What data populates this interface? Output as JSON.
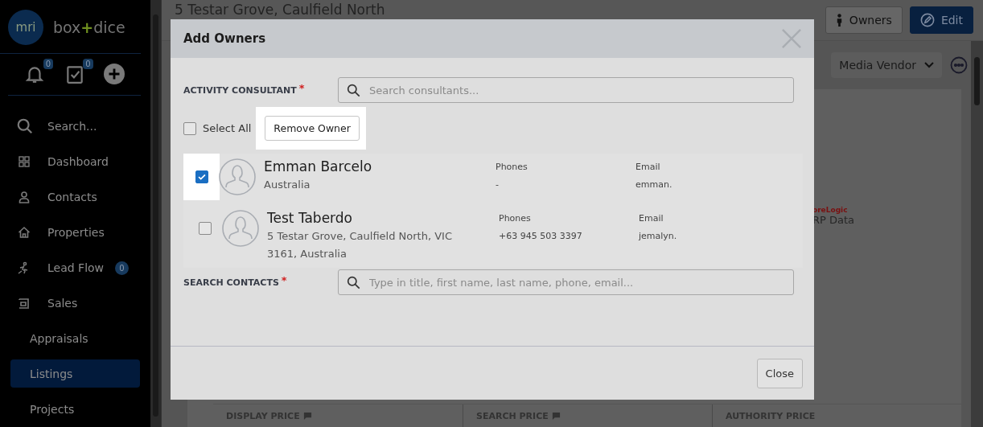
{
  "sidebar": {
    "logo_mark": "mri",
    "brand": "box**+**dice",
    "quick_icons": [
      {
        "kind": "bell",
        "badge": "0"
      },
      {
        "kind": "tasks",
        "badge": "0"
      },
      {
        "kind": "add"
      }
    ],
    "items": [
      {
        "kind": "search",
        "label": "Search...",
        "selected": false
      },
      {
        "kind": "dashboard",
        "label": "Dashboard",
        "selected": false
      },
      {
        "kind": "contacts",
        "label": "Contacts",
        "selected": false
      },
      {
        "kind": "properties",
        "label": "Properties",
        "selected": false
      },
      {
        "kind": "leadflow",
        "label": "Lead Flow",
        "badge": "0",
        "selected": false
      },
      {
        "kind": "sales",
        "label": "Sales",
        "selected": false
      },
      {
        "kind": "sub",
        "label": "Appraisals",
        "selected": false
      },
      {
        "kind": "sub",
        "label": "Listings",
        "selected": true
      },
      {
        "kind": "sub",
        "label": "Projects",
        "selected": false
      }
    ]
  },
  "header": {
    "title": "5 Testar Grove, Caulfield North",
    "buttons": [
      {
        "kind": "owners",
        "label": "Owners"
      },
      {
        "kind": "edit",
        "label": "Edit"
      }
    ]
  },
  "toolbar": {
    "dropdown": "Media Vendor"
  },
  "logo_fragment": {
    "top": "oreLogic",
    "bottom": "RP Data"
  },
  "price_columns": [
    {
      "label": "DISPLAY PRICE",
      "flag": true
    },
    {
      "label": "SEARCH PRICE",
      "flag": true
    },
    {
      "label": "AUTHORITY PRICE",
      "flag": false
    }
  ],
  "modal": {
    "title": "Add Owners",
    "consultant": {
      "label": "ACTIVITY CONSULTANT",
      "required_mark": "*",
      "placeholder": "Search consultants..."
    },
    "select_all": {
      "label": "Select All",
      "checked": false
    },
    "remove_button": "Remove Owner",
    "contacts": [
      {
        "name": "Emman Barcelo",
        "address": "Australia",
        "phones_label": "Phones",
        "phone": "-",
        "email_label": "Email",
        "email": "emman.",
        "checked": true
      },
      {
        "name": "Test Taberdo",
        "address": "5 Testar Grove, Caulfield North, VIC 3161, Australia",
        "phones_label": "Phones",
        "phone": "+63 945 503 3397",
        "email_label": "Email",
        "email": "jemalyn.",
        "checked": false
      }
    ],
    "search_contacts": {
      "label": "SEARCH CONTACTS",
      "required_mark": "*",
      "placeholder": "Type in title, first name, last name, phone, email..."
    },
    "close_button": "Close"
  }
}
